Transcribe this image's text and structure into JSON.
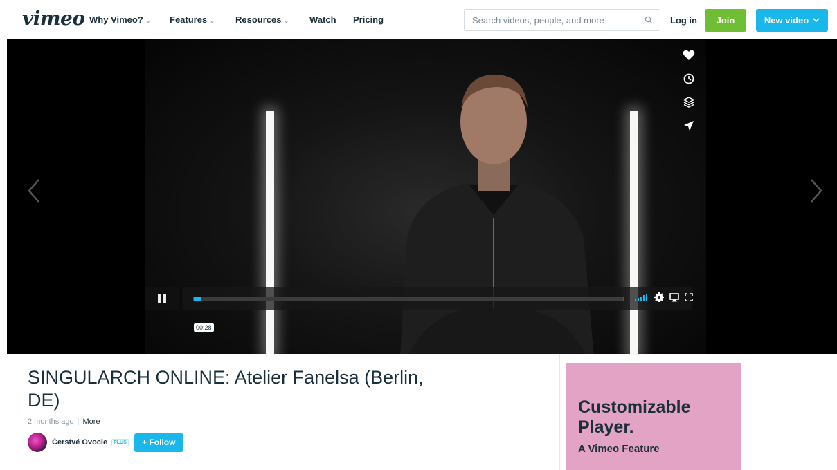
{
  "header": {
    "logo": "vimeo",
    "nav": [
      {
        "label": "Why Vimeo?",
        "has_menu": true
      },
      {
        "label": "Features",
        "has_menu": true
      },
      {
        "label": "Resources",
        "has_menu": true
      },
      {
        "label": "Watch",
        "has_menu": false
      },
      {
        "label": "Pricing",
        "has_menu": false
      }
    ],
    "search_placeholder": "Search videos, people, and more",
    "login_label": "Log in",
    "join_label": "Join",
    "new_video_label": "New video"
  },
  "player": {
    "timecode": "00:28",
    "progress_fraction": 0.016,
    "side_icons": [
      "heart-icon",
      "clock-icon",
      "layers-icon",
      "send-icon"
    ],
    "control_icons": [
      "volume-icon",
      "settings-icon",
      "airplay-icon",
      "fullscreen-icon"
    ]
  },
  "video": {
    "title": "SINGULARCH ONLINE: Atelier Fanelsa (Berlin, DE)",
    "posted": "2 months ago",
    "more_label": "More",
    "owner_name": "Čerstvé Ovocie",
    "owner_badge": "PLUS",
    "follow_label": "+ Follow"
  },
  "ad": {
    "headline": "Customizable Player.",
    "subline": "A Vimeo Feature"
  },
  "colors": {
    "brand_blue": "#1ab7ea",
    "join_green": "#6fbe34",
    "ad_pink": "#e3a3c4",
    "text_dark": "#1a2e3b"
  }
}
